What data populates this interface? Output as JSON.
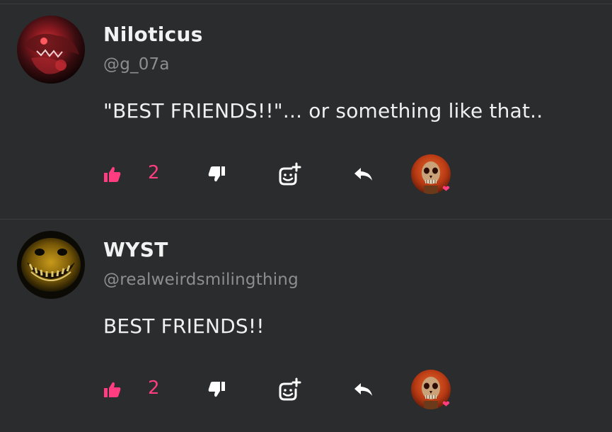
{
  "colors": {
    "background": "#2a2c2d",
    "accent_pink": "#ff3d7f",
    "text_primary": "#f2f2f2",
    "text_secondary": "#8c8f92"
  },
  "comments": [
    {
      "username": "Niloticus",
      "handle": "@g_07a",
      "text": "\"BEST FRIENDS!!\"... or something like that..",
      "likes": "2",
      "avatar_icon": "red-creature-avatar",
      "reactor_icon": "skull-avatar",
      "reactor_badge_icon": "heart-icon"
    },
    {
      "username": "WYST",
      "handle": "@realweirdsmilingthing",
      "text": "BEST FRIENDS!!",
      "likes": "2",
      "avatar_icon": "smiling-creature-avatar",
      "reactor_icon": "skull-avatar",
      "reactor_badge_icon": "heart-icon"
    }
  ]
}
